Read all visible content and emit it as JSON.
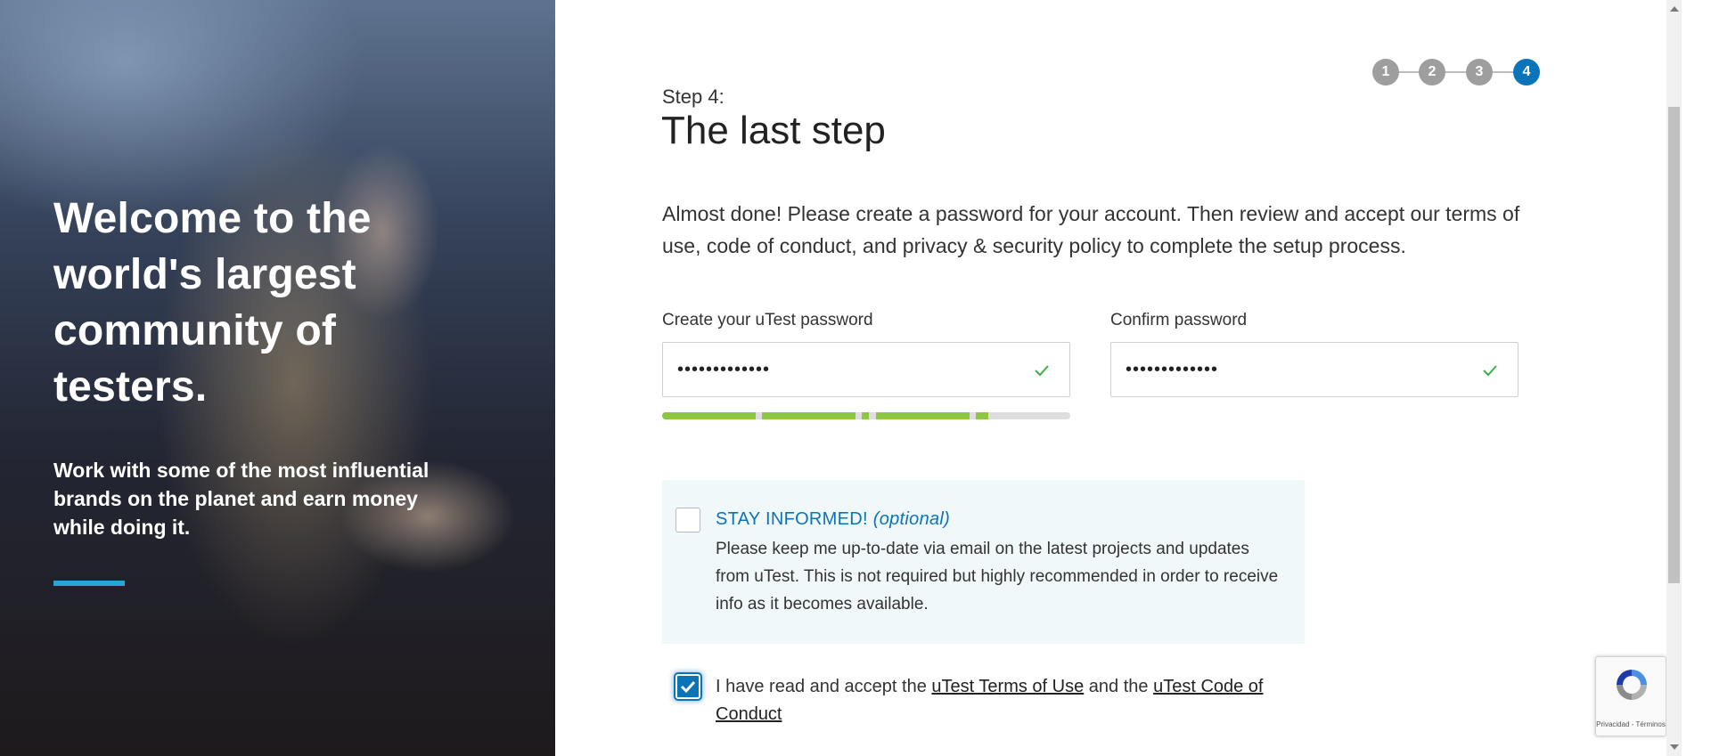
{
  "hero": {
    "title": "Welcome to the world's largest community of testers.",
    "subtitle": "Work with some of the most influential brands on the planet and earn money while doing it.",
    "accent_color": "#25a6d5"
  },
  "stepper": {
    "steps": [
      "1",
      "2",
      "3",
      "4"
    ],
    "active_step": "4",
    "inactive_color": "#9e9e9e",
    "active_color": "#0b73b8"
  },
  "header": {
    "step_label": "Step 4:",
    "title": "The last step"
  },
  "intro": "Almost done! Please create a password for your account. Then review and accept our terms of use, code of conduct, and privacy & security policy to complete the setup process.",
  "form": {
    "password": {
      "label": "Create your uTest password",
      "value": "•••••••••••••",
      "valid": true
    },
    "confirm_password": {
      "label": "Confirm password",
      "value": "•••••••••••••",
      "valid": true
    },
    "strength_meter": {
      "fill_fraction": 0.8,
      "color": "#8dc63f"
    },
    "stay_informed": {
      "title": "STAY INFORMED!",
      "optional": "(optional)",
      "text": "Please keep me up-to-date via email on the latest projects and updates from uTest. This is not required but highly recommended in order to receive info as it becomes available.",
      "checked": false
    },
    "terms": {
      "prefix": "I have read and accept the",
      "link_terms": "uTest Terms of Use",
      "middle": "and the",
      "link_conduct": "uTest Code of Conduct",
      "checked": true
    }
  },
  "recaptcha": {
    "text": "Privacidad - Términos"
  }
}
